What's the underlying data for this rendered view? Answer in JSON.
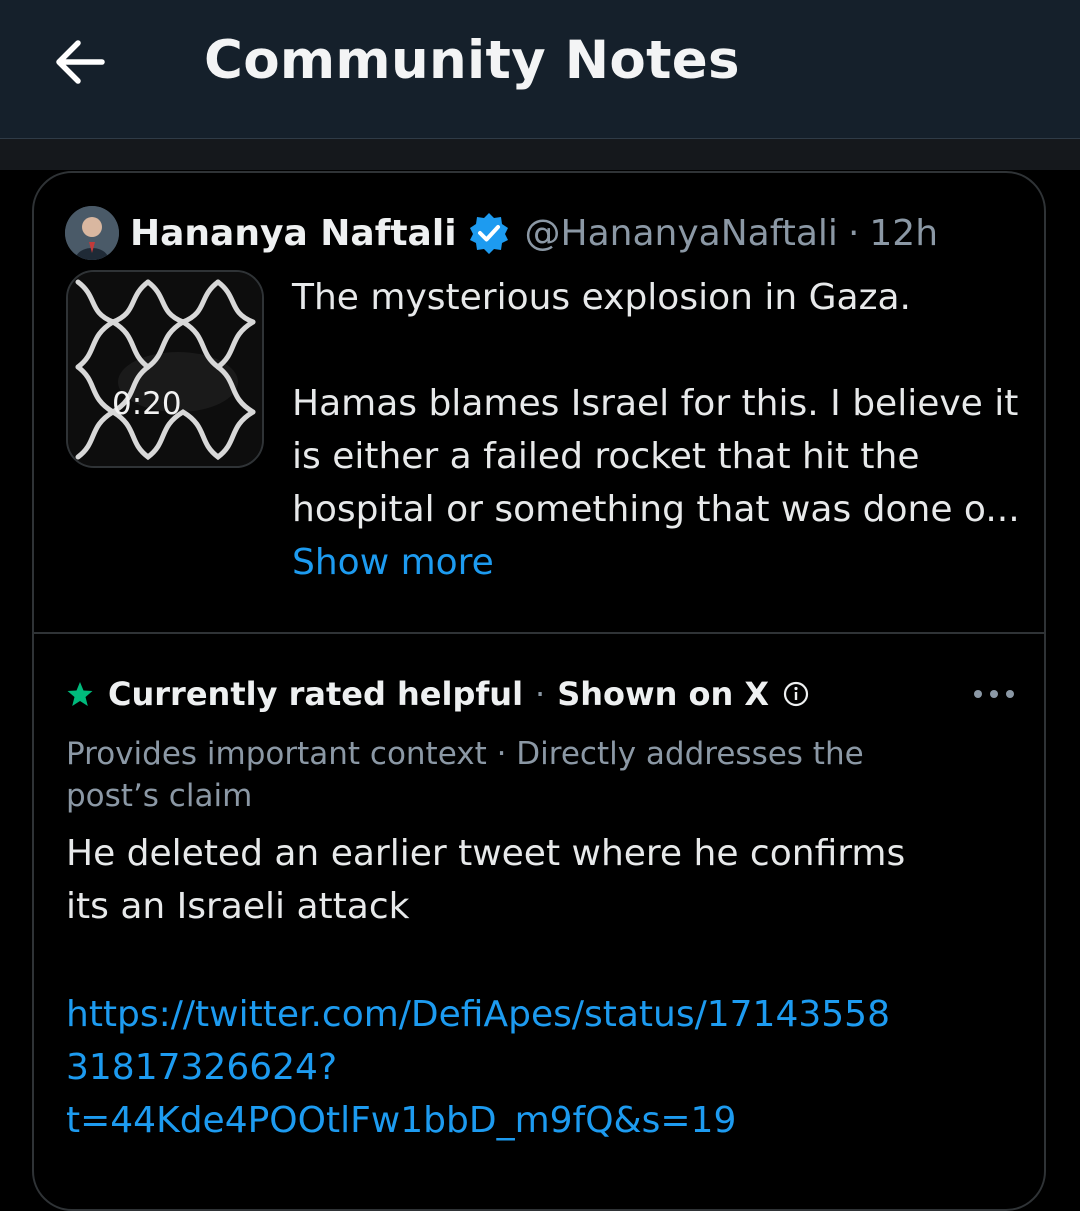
{
  "header": {
    "title": "Community Notes",
    "back_icon": "arrow-left-icon"
  },
  "post": {
    "author_name": "Hananya Naftali",
    "verified_icon": "verified-badge-icon",
    "handle": "@HananyaNaftali",
    "separator": "·",
    "time": "12h",
    "video_duration": "0:20",
    "text_line1": "The mysterious explosion in Gaza.",
    "text_lines": [
      "Hamas blames Israel for this. I believe it",
      "is either a failed rocket that hit the",
      "hospital or something that was done o..."
    ],
    "show_more": "Show more"
  },
  "note": {
    "status": "Currently rated helpful",
    "separator": "·",
    "shown_on": "Shown on X",
    "star_color": "#00ba7c",
    "tags": "Provides important context · Directly addresses the post’s claim",
    "body_lines": [
      "He deleted an earlier tweet where he confirms",
      "its an Israeli attack"
    ],
    "link_lines": [
      "https://twitter.com/DefiApes/status/17143558",
      "31817326624?",
      "t=44Kde4POOtlFw1bbD_m9fQ&s=19"
    ]
  },
  "colors": {
    "header_bg": "#15202b",
    "link": "#1d9bf0",
    "verified": "#1d9bf0",
    "secondary_text": "#8b98a5"
  }
}
